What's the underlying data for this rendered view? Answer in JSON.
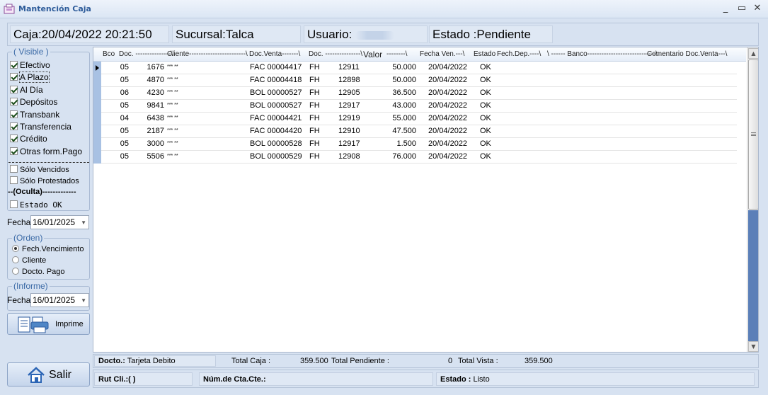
{
  "window": {
    "title": "Mantención Caja",
    "icon": "cash-register-icon"
  },
  "header": {
    "caja_label": "Caja:",
    "caja_value": "20/04/2022  20:21:50",
    "sucursal_label": "Sucursal:",
    "sucursal_value": "Talca",
    "usuario_label": "Usuario:",
    "estado_label": "Estado :",
    "estado_value": "Pendiente"
  },
  "visible": {
    "legend": "( Visible )",
    "items": [
      {
        "label": "Efectivo",
        "checked": true
      },
      {
        "label": "A Plazo",
        "checked": true
      },
      {
        "label": "Al Día",
        "checked": true
      },
      {
        "label": "Depósitos",
        "checked": true
      },
      {
        "label": "Transbank",
        "checked": true
      },
      {
        "label": "Transferencia",
        "checked": true
      },
      {
        "label": "Crédito",
        "checked": true
      },
      {
        "label": "Otras form.Pago",
        "checked": true
      }
    ],
    "filters": [
      {
        "label": "Sólo Vencidos",
        "checked": false
      },
      {
        "label": "Sólo Protestados",
        "checked": false
      }
    ],
    "oculta_label": "--(Oculta)-------------",
    "estado_ok_label": "Estado OK",
    "fecha_label": "Fecha",
    "fecha_value": "16/01/2025"
  },
  "orden": {
    "legend": "(Orden)",
    "options": [
      {
        "label": "Fech.Vencimiento",
        "selected": true
      },
      {
        "label": "Cliente",
        "selected": false
      },
      {
        "label": "Docto. Pago",
        "selected": false
      }
    ]
  },
  "informe": {
    "legend": "(Informe)",
    "fecha_label": "Fecha",
    "fecha_value": "16/01/2025",
    "print_label": "Imprime"
  },
  "exit_label": "Salir",
  "grid": {
    "headers": {
      "bco": "Bco",
      "doc": "Doc. ---------------\\",
      "cliente": "Cliente------------------------\\",
      "doc_venta": "Doc.Venta-------\\",
      "valor": "Valor",
      "valor_tail": "--------\\",
      "fecha_ven": "Fecha Ven.---\\",
      "estado": "Estado",
      "fech_dep": "Fech.Dep.----\\",
      "banco": "\\ ------ Banco-----------------------------\\",
      "comentario": "Comentario Doc.Venta---\\"
    },
    "rows": [
      {
        "bco": "05",
        "doc": "1676",
        "cliente": "*** **",
        "doc_venta": "FAC 00004417",
        "tipo": "FH",
        "num": "12911",
        "valor": "50.000",
        "fecha_ven": "20/04/2022",
        "estado": "OK"
      },
      {
        "bco": "05",
        "doc": "4870",
        "cliente": "*** **",
        "doc_venta": "FAC 00004418",
        "tipo": "FH",
        "num": "12898",
        "valor": "50.000",
        "fecha_ven": "20/04/2022",
        "estado": "OK"
      },
      {
        "bco": "06",
        "doc": "4230",
        "cliente": "*** **",
        "doc_venta": "BOL 00000527",
        "tipo": "FH",
        "num": "12905",
        "valor": "36.500",
        "fecha_ven": "20/04/2022",
        "estado": "OK"
      },
      {
        "bco": "05",
        "doc": "9841",
        "cliente": "*** **",
        "doc_venta": "BOL 00000527",
        "tipo": "FH",
        "num": "12917",
        "valor": "43.000",
        "fecha_ven": "20/04/2022",
        "estado": "OK"
      },
      {
        "bco": "04",
        "doc": "6438",
        "cliente": "*** **",
        "doc_venta": "FAC 00004421",
        "tipo": "FH",
        "num": "12919",
        "valor": "55.000",
        "fecha_ven": "20/04/2022",
        "estado": "OK"
      },
      {
        "bco": "05",
        "doc": "2187",
        "cliente": "*** **",
        "doc_venta": "FAC 00004420",
        "tipo": "FH",
        "num": "12910",
        "valor": "47.500",
        "fecha_ven": "20/04/2022",
        "estado": "OK"
      },
      {
        "bco": "05",
        "doc": "3000",
        "cliente": "*** **",
        "doc_venta": "BOL 00000528",
        "tipo": "FH",
        "num": "12917",
        "valor": "1.500",
        "fecha_ven": "20/04/2022",
        "estado": "OK"
      },
      {
        "bco": "05",
        "doc": "5506",
        "cliente": "*** **",
        "doc_venta": "BOL 00000529",
        "tipo": "FH",
        "num": "12908",
        "valor": "76.000",
        "fecha_ven": "20/04/2022",
        "estado": "OK"
      }
    ]
  },
  "totals": {
    "docto_label": "Docto.:",
    "docto_value": "Tarjeta Debito",
    "total_caja_label": "Total Caja :",
    "total_caja_value": "359.500",
    "total_pendiente_label": "Total Pendiente :",
    "total_pendiente_value": "0",
    "total_vista_label": "Total Vista :",
    "total_vista_value": "359.500"
  },
  "status": {
    "rut_label": "Rut Cli.:",
    "rut_value": "(                  )",
    "cta_label": "Núm.de Cta.Cte.:",
    "estado_label": "Estado :",
    "estado_value": "Listo"
  },
  "colors": {
    "accent": "#2e5c9a",
    "background": "#d7e2f1",
    "row_header": "#a8c1e3",
    "scroll_track": "#5b7fb8"
  }
}
